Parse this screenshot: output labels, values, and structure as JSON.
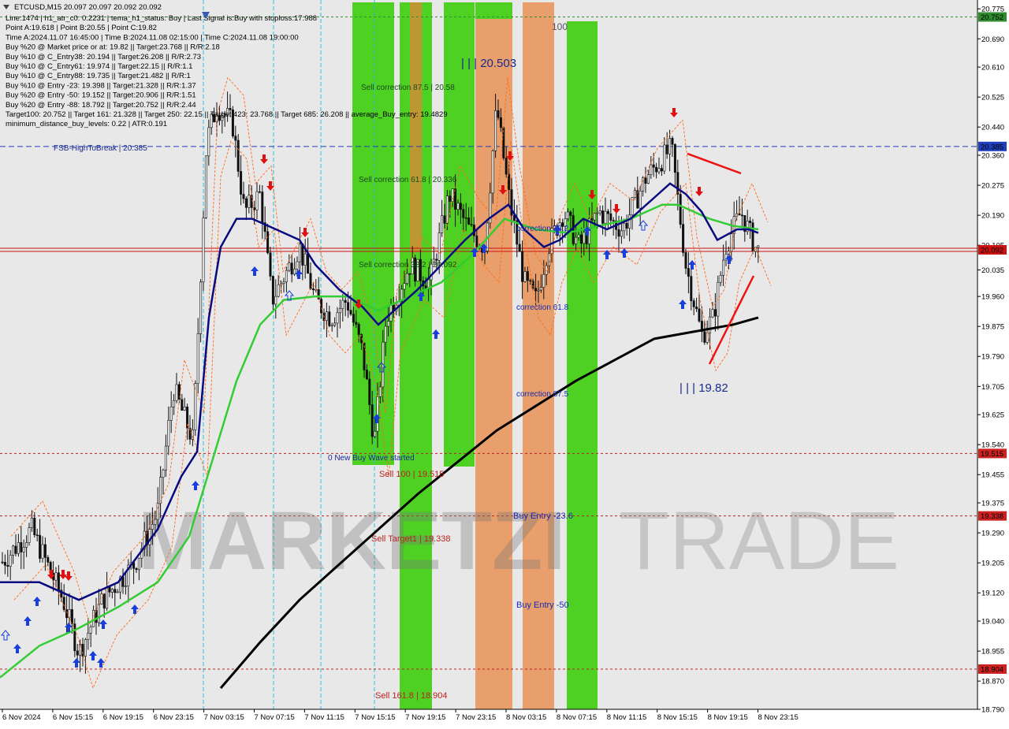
{
  "window": {
    "symbol_line": "ETCUSD,M15  20.097 20.097 20.092 20.092"
  },
  "info_lines": [
    "Line:1474  |  h1_atr_c0: 0.2231  |  tema_h1_status: Buy  |  Last Signal is:Buy with stoploss:17.988",
    "Point A:19.618  |  Point B:20.55  |  Point C:19.82",
    "Time A:2024.11.07 16:45:00  |  Time B:2024.11.08 02:15:00  |  Time C:2024.11.08 19:00:00",
    "Buy %20 @ Market price or at: 19.82  ||  Target:23.768  ||  R/R:2.18",
    "Buy %10 @ C_Entry38: 20.194  ||  Target:26.208  ||  R/R:2.73",
    "Buy %10 @ C_Entry61: 19.974  ||  Target:22.15  ||  R/R:1.1",
    "Buy %10 @ C_Entry88: 19.735  ||  Target:21.482  ||  R/R:1",
    "Buy %10 @ Entry -23: 19.398  ||  Target:21.328  ||  R/R:1.37",
    "Buy %20 @ Entry -50: 19.152  ||  Target:20.906  ||  R/R:1.51",
    "Buy %20 @ Entry -88: 18.792  ||  Target:20.752  ||  R/R:2.44",
    "Target100: 20.752  ||  Target 161: 21.328  ||  Target 250: 22.15  ||  Target 423: 23.768  ||  Target 685: 26.208  ||  average_Buy_entry: 19.4829",
    "minimum_distance_buy_levels: 0.22  |  ATR:0.191"
  ],
  "price_axis": {
    "ticks": [
      "20.775",
      "20.690",
      "20.610",
      "20.525",
      "20.440",
      "20.360",
      "20.275",
      "20.190",
      "20.105",
      "20.035",
      "19.960",
      "19.875",
      "19.790",
      "19.705",
      "19.625",
      "19.540",
      "19.455",
      "19.375",
      "19.290",
      "19.205",
      "19.120",
      "19.040",
      "18.955",
      "18.870",
      "18.790"
    ],
    "highlighted": [
      {
        "value": "20.752",
        "color": "#2e8b2e"
      },
      {
        "value": "20.385",
        "color": "#1f3fbf"
      },
      {
        "value": "20.092",
        "color": "#cc1111"
      },
      {
        "value": "19.515",
        "color": "#cc2222"
      },
      {
        "value": "19.338",
        "color": "#cc2222"
      },
      {
        "value": "18.904",
        "color": "#cc2222"
      }
    ],
    "range": [
      18.79,
      20.8
    ]
  },
  "time_axis": {
    "labels": [
      "6 Nov 2024",
      "6 Nov 15:15",
      "6 Nov 19:15",
      "6 Nov 23:15",
      "7 Nov 03:15",
      "7 Nov 07:15",
      "7 Nov 11:15",
      "7 Nov 15:15",
      "7 Nov 19:15",
      "7 Nov 23:15",
      "8 Nov 03:15",
      "8 Nov 07:15",
      "8 Nov 11:15",
      "8 Nov 15:15",
      "8 Nov 19:15",
      "8 Nov 23:15"
    ]
  },
  "annotations": {
    "fsb_label": "FSB-HighToBreak  |  20.385",
    "point_b": "| | | 20.503",
    "point_c": "| | | 19.82",
    "top_100": "100",
    "sell_corr_875": "Sell correction 87.5 | 20.58",
    "sell_corr_618": "Sell correction 61.8 | 20.336",
    "sell_corr_382": "Sell correction 38.2 | 20.092",
    "new_wave": "0 New Buy Wave started",
    "sell_100": "Sell 100 | 19.515",
    "sell_target1": "Sell Target1 | 19.338",
    "sell_1618": "Sell 161.8 | 18.904",
    "corr_382": "correction 38.2",
    "corr_618": "correction 61.8",
    "corr_875": "correction 87.5",
    "buy_entry_236": "Buy Entry -23.6",
    "buy_entry_50": "Buy Entry -50",
    "watermark_left": "MARKETZI",
    "watermark_right": "TRADE"
  },
  "colors": {
    "bull": "#66dd22",
    "bear": "#ff8844",
    "zone_green": "#33cc00",
    "zone_orange": "#e8823a",
    "ma_navy": "#0a0a80",
    "ma_green": "#33cc33",
    "ma_black": "#000000",
    "buy_arrow": "#1a3fd8",
    "sell_arrow": "#e01010"
  },
  "chart_data": {
    "type": "candlestick",
    "symbol": "ETCUSD",
    "timeframe": "M15",
    "y_range": [
      18.79,
      20.8
    ],
    "key_levels": {
      "target100": 20.752,
      "fsb_high_to_break": 20.385,
      "current_price": 20.092,
      "sell_100": 19.515,
      "sell_target1": 19.338,
      "sell_161_8": 18.904
    },
    "price_path": [
      [
        0,
        19.2
      ],
      [
        40,
        19.3
      ],
      [
        80,
        19.1
      ],
      [
        100,
        18.95
      ],
      [
        130,
        19.1
      ],
      [
        170,
        19.2
      ],
      [
        200,
        19.35
      ],
      [
        220,
        19.7
      ],
      [
        245,
        19.55
      ],
      [
        262,
        20.4
      ],
      [
        275,
        20.5
      ],
      [
        295,
        20.45
      ],
      [
        310,
        20.2
      ],
      [
        330,
        20.25
      ],
      [
        345,
        19.95
      ],
      [
        380,
        20.1
      ],
      [
        400,
        19.95
      ],
      [
        420,
        19.9
      ],
      [
        440,
        19.95
      ],
      [
        460,
        19.8
      ],
      [
        475,
        19.55
      ],
      [
        490,
        19.9
      ],
      [
        520,
        20.05
      ],
      [
        545,
        20.0
      ],
      [
        570,
        20.25
      ],
      [
        595,
        20.15
      ],
      [
        615,
        20.1
      ],
      [
        630,
        20.5
      ],
      [
        645,
        20.25
      ],
      [
        665,
        20.0
      ],
      [
        680,
        19.95
      ],
      [
        695,
        20.1
      ],
      [
        715,
        20.2
      ],
      [
        735,
        20.1
      ],
      [
        760,
        20.2
      ],
      [
        790,
        20.15
      ],
      [
        820,
        20.3
      ],
      [
        852,
        20.38
      ],
      [
        870,
        20.05
      ],
      [
        890,
        19.85
      ],
      [
        905,
        19.9
      ],
      [
        920,
        20.1
      ],
      [
        940,
        20.2
      ],
      [
        960,
        20.09
      ]
    ],
    "ma_navy": [
      [
        0,
        19.15
      ],
      [
        50,
        19.15
      ],
      [
        100,
        19.1
      ],
      [
        150,
        19.15
      ],
      [
        200,
        19.3
      ],
      [
        230,
        19.45
      ],
      [
        250,
        19.52
      ],
      [
        265,
        19.9
      ],
      [
        280,
        20.1
      ],
      [
        300,
        20.18
      ],
      [
        320,
        20.18
      ],
      [
        350,
        20.15
      ],
      [
        380,
        20.12
      ],
      [
        400,
        20.05
      ],
      [
        430,
        19.98
      ],
      [
        460,
        19.93
      ],
      [
        480,
        19.88
      ],
      [
        500,
        19.92
      ],
      [
        530,
        19.98
      ],
      [
        560,
        20.05
      ],
      [
        590,
        20.12
      ],
      [
        620,
        20.18
      ],
      [
        645,
        20.22
      ],
      [
        665,
        20.15
      ],
      [
        690,
        20.1
      ],
      [
        710,
        20.12
      ],
      [
        740,
        20.18
      ],
      [
        770,
        20.15
      ],
      [
        800,
        20.18
      ],
      [
        830,
        20.24
      ],
      [
        850,
        20.28
      ],
      [
        870,
        20.25
      ],
      [
        890,
        20.2
      ],
      [
        910,
        20.12
      ],
      [
        935,
        20.15
      ],
      [
        950,
        20.15
      ],
      [
        962,
        20.14
      ]
    ],
    "ma_green": [
      [
        0,
        18.88
      ],
      [
        50,
        18.97
      ],
      [
        100,
        19.02
      ],
      [
        150,
        19.08
      ],
      [
        200,
        19.15
      ],
      [
        240,
        19.28
      ],
      [
        270,
        19.5
      ],
      [
        300,
        19.72
      ],
      [
        330,
        19.88
      ],
      [
        360,
        19.95
      ],
      [
        400,
        19.96
      ],
      [
        440,
        19.96
      ],
      [
        480,
        19.92
      ],
      [
        520,
        19.96
      ],
      [
        560,
        20.0
      ],
      [
        600,
        20.08
      ],
      [
        640,
        20.18
      ],
      [
        680,
        20.15
      ],
      [
        720,
        20.14
      ],
      [
        760,
        20.16
      ],
      [
        800,
        20.18
      ],
      [
        840,
        20.22
      ],
      [
        860,
        20.22
      ],
      [
        880,
        20.2
      ],
      [
        900,
        20.18
      ],
      [
        930,
        20.16
      ],
      [
        962,
        20.15
      ]
    ],
    "ma_black": [
      [
        280,
        18.85
      ],
      [
        330,
        18.98
      ],
      [
        380,
        19.1
      ],
      [
        430,
        19.2
      ],
      [
        480,
        19.3
      ],
      [
        530,
        19.4
      ],
      [
        580,
        19.49
      ],
      [
        630,
        19.58
      ],
      [
        680,
        19.65
      ],
      [
        730,
        19.72
      ],
      [
        780,
        19.78
      ],
      [
        830,
        19.84
      ],
      [
        880,
        19.86
      ],
      [
        930,
        19.88
      ],
      [
        962,
        19.9
      ]
    ]
  }
}
